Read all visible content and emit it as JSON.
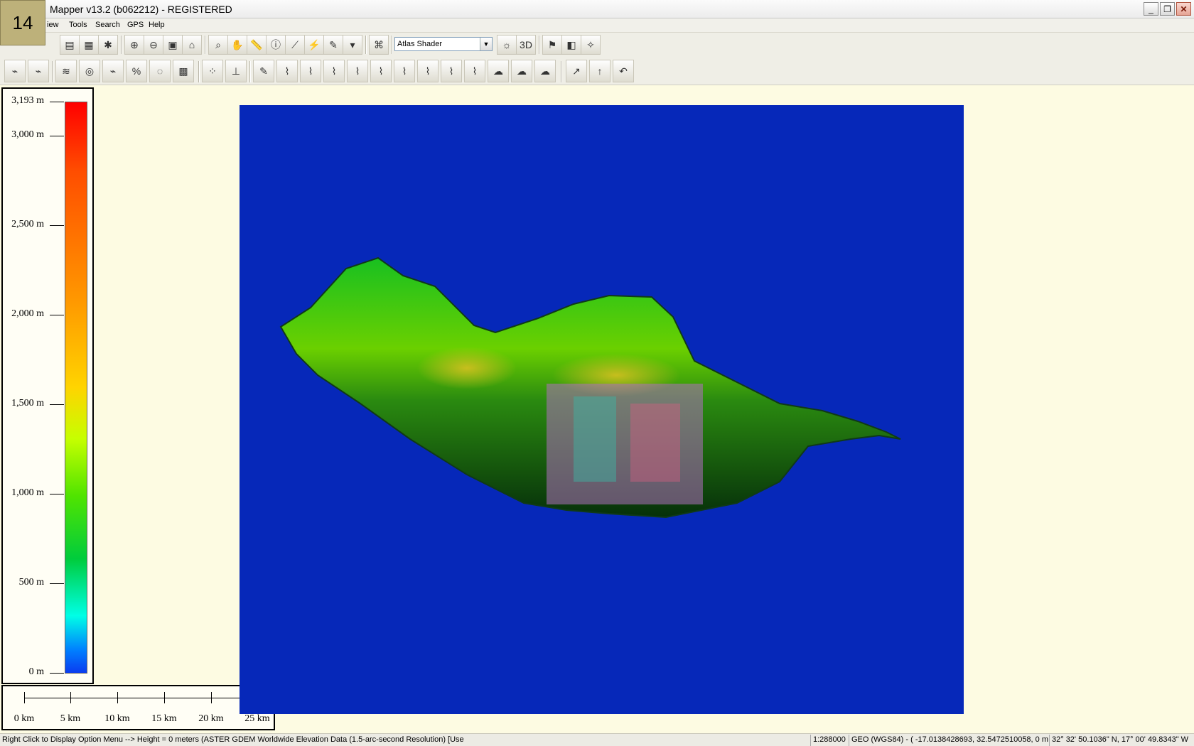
{
  "window": {
    "title": "Mapper v13.2 (b062212) - REGISTERED",
    "badge": "14"
  },
  "menubar": [
    "View",
    "Tools",
    "Search",
    "GPS",
    "Help"
  ],
  "menu_partial_first": "iew",
  "toolbar": {
    "shader_selected": "Atlas Shader"
  },
  "legend": {
    "labels": [
      "3,193 m",
      "3,000 m",
      "2,500 m",
      "2,000 m",
      "1,500 m",
      "1,000 m",
      "500 m",
      "0 m"
    ],
    "max_elevation": 3193,
    "colors": [
      "#ff0000",
      "#ff9900",
      "#ffd400",
      "#50e400",
      "#00ffe6",
      "#0a3cf0"
    ]
  },
  "scale": {
    "labels": [
      "0 km",
      "5 km",
      "10 km",
      "15 km",
      "20 km",
      "25 km"
    ]
  },
  "map": {
    "water_color": "#0628b9",
    "land_colors": [
      "#00a020",
      "#7fd000",
      "#d0c000",
      "#003a0c"
    ]
  },
  "status": {
    "hint": "Right Click to Display Option Menu --> Height = 0 meters (ASTER GDEM Worldwide Elevation Data (1.5-arc-second Resolution) [Use",
    "scale": "1:288000",
    "projection": "GEO (WGS84) - ( -17.0138428693, 32.5472510058, 0 m )",
    "coords": "32° 32' 50.1036\" N, 17° 00' 49.8343\" W"
  }
}
